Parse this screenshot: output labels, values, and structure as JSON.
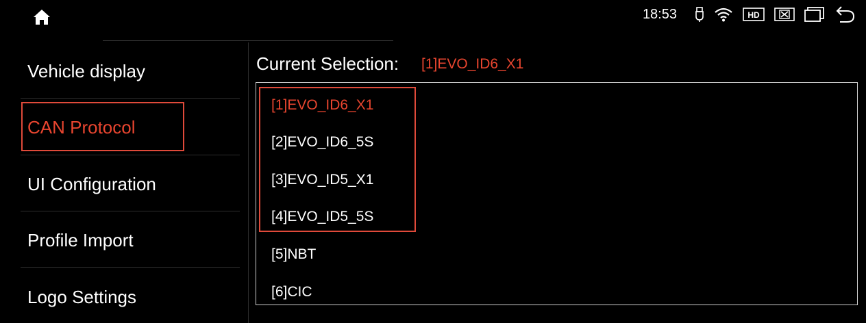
{
  "status": {
    "time": "18:53",
    "hd_badge": "HD"
  },
  "sidebar": {
    "items": [
      {
        "label": "Vehicle display"
      },
      {
        "label": "CAN Protocol"
      },
      {
        "label": "UI Configuration"
      },
      {
        "label": "Profile Import"
      },
      {
        "label": "Logo Settings"
      }
    ],
    "selected_index": 1
  },
  "main": {
    "current_label": "Current Selection:",
    "current_value": "[1]EVO_ID6_X1",
    "protocols": [
      {
        "label": "[1]EVO_ID6_X1"
      },
      {
        "label": "[2]EVO_ID6_5S"
      },
      {
        "label": "[3]EVO_ID5_X1"
      },
      {
        "label": "[4]EVO_ID5_5S"
      },
      {
        "label": "[5]NBT"
      },
      {
        "label": "[6]CIC"
      }
    ],
    "selected_index": 0
  },
  "colors": {
    "accent": "#e8452f",
    "background": "#000000",
    "text": "#ffffff"
  },
  "icons": [
    "home-icon",
    "usb-icon",
    "wifi-icon",
    "hd-icon",
    "close-icon",
    "window-icon",
    "back-icon"
  ]
}
